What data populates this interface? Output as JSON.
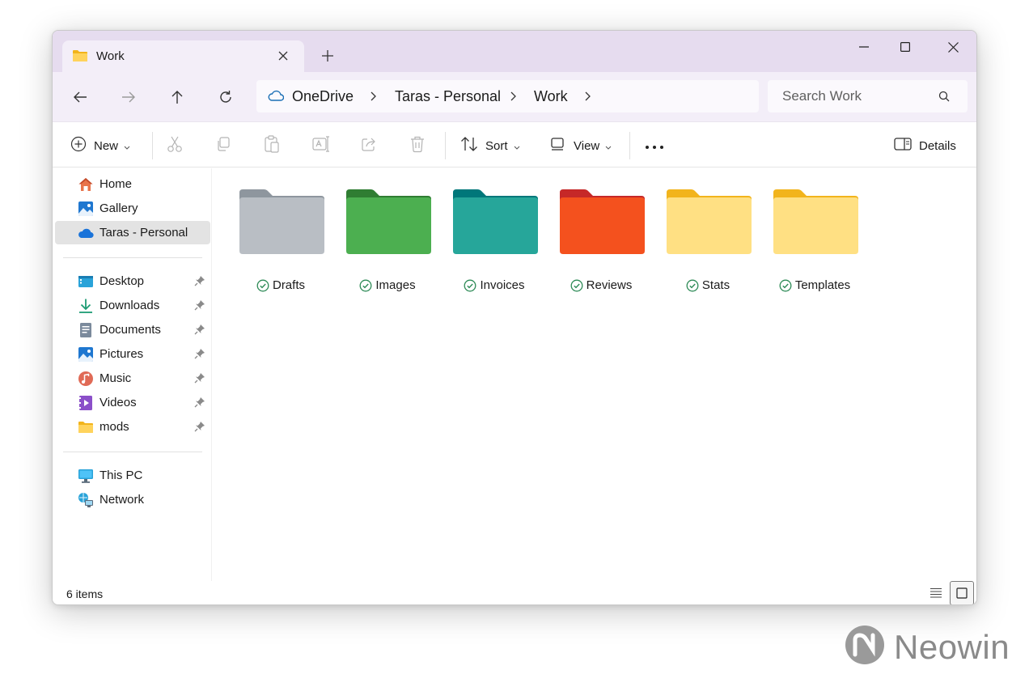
{
  "window": {
    "tab": {
      "title": "Work",
      "icon": "folder-icon"
    },
    "controls": [
      "minimize-icon",
      "maximize-icon",
      "close-icon"
    ]
  },
  "address": {
    "cloud_icon": "onedrive-icon",
    "crumbs": [
      "OneDrive",
      "Taras - Personal",
      "Work"
    ],
    "search_placeholder": "Search Work"
  },
  "commandbar": {
    "new_label": "New",
    "sort_label": "Sort",
    "view_label": "View",
    "details_label": "Details",
    "actions": [
      "cut-icon",
      "copy-icon",
      "paste-icon",
      "rename-icon",
      "share-icon",
      "delete-icon"
    ]
  },
  "sidebar": {
    "top": [
      {
        "label": "Home",
        "icon": "home-icon"
      },
      {
        "label": "Gallery",
        "icon": "gallery-icon"
      },
      {
        "label": "Taras - Personal",
        "icon": "onedrive-icon",
        "selected": true
      }
    ],
    "pinned": [
      {
        "label": "Desktop",
        "icon": "desktop-icon"
      },
      {
        "label": "Downloads",
        "icon": "downloads-icon"
      },
      {
        "label": "Documents",
        "icon": "documents-icon"
      },
      {
        "label": "Pictures",
        "icon": "pictures-icon"
      },
      {
        "label": "Music",
        "icon": "music-icon"
      },
      {
        "label": "Videos",
        "icon": "videos-icon"
      },
      {
        "label": "mods",
        "icon": "folder-icon"
      }
    ],
    "devices": [
      {
        "label": "This PC",
        "icon": "this-pc-icon"
      },
      {
        "label": "Network",
        "icon": "network-icon"
      }
    ]
  },
  "folders": [
    {
      "name": "Drafts",
      "back": "#8e969e",
      "front": "#b9bec4",
      "front2": "#a6acb3"
    },
    {
      "name": "Images",
      "back": "#2f7d32",
      "front": "#4caf50",
      "front2": "#388e3c"
    },
    {
      "name": "Invoices",
      "back": "#00777a",
      "front": "#26a69a",
      "front2": "#12877f"
    },
    {
      "name": "Reviews",
      "back": "#c62828",
      "front": "#f4511e",
      "front2": "#e53935"
    },
    {
      "name": "Stats",
      "back": "#f2b41c",
      "front": "#ffe083",
      "front2": "#fdc83a"
    },
    {
      "name": "Templates",
      "back": "#f2b41c",
      "front": "#ffe083",
      "front2": "#fdc83a"
    }
  ],
  "status": {
    "count": "6 items"
  },
  "watermark": {
    "text": "Neowin"
  }
}
